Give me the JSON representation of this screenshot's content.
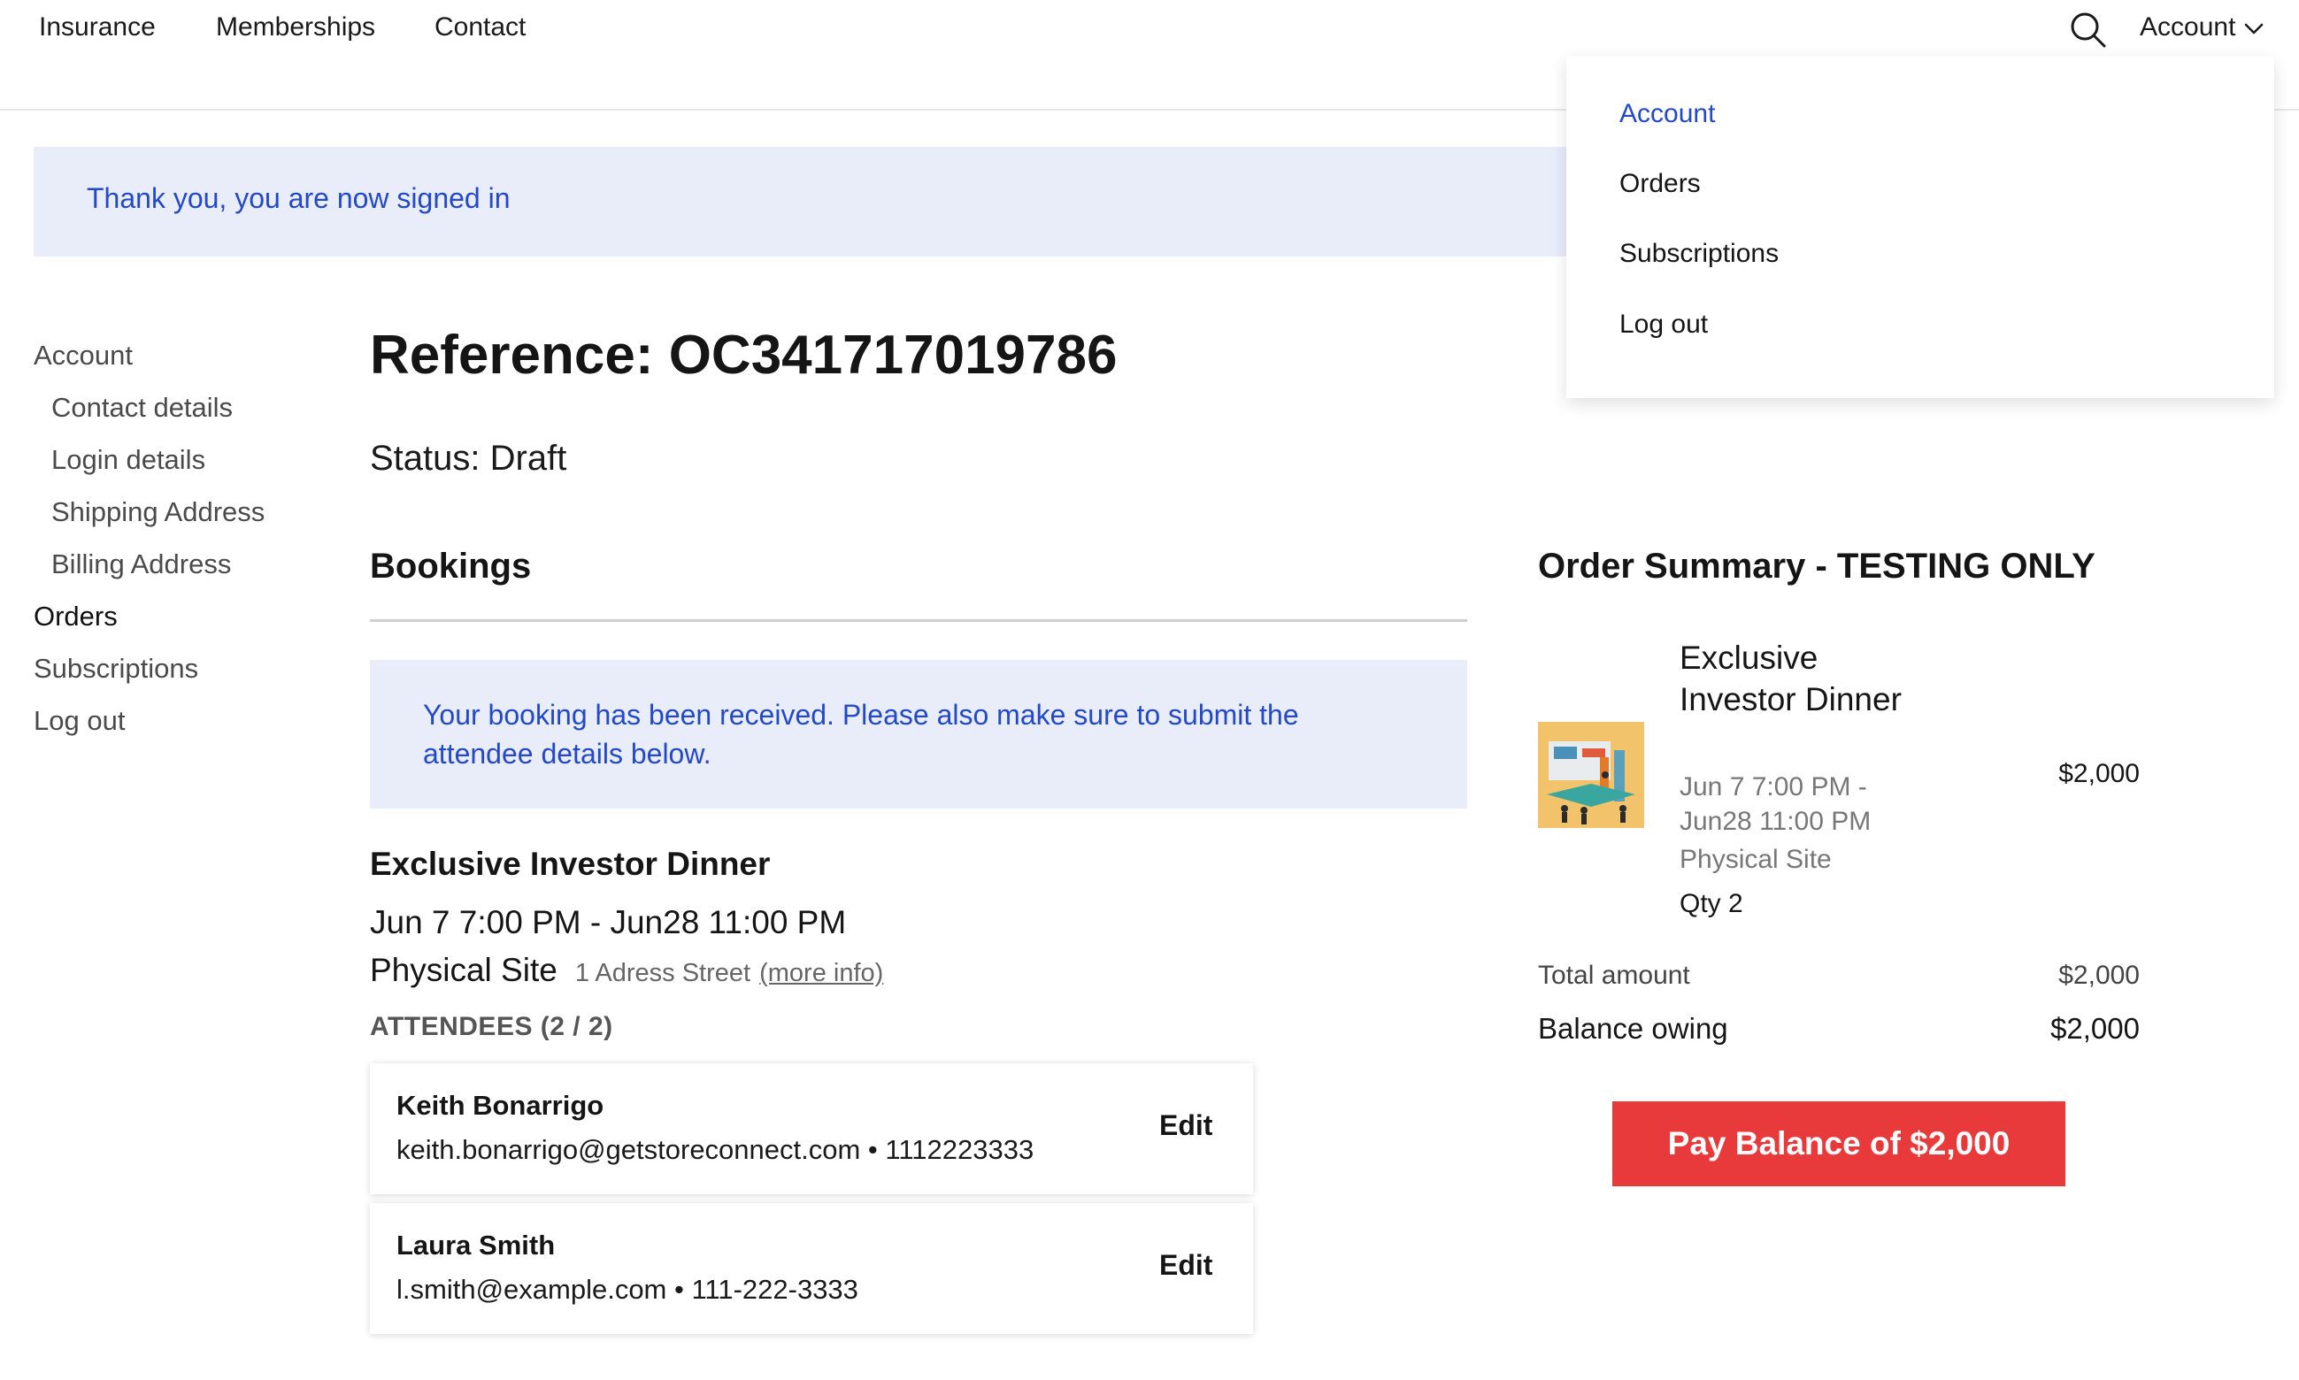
{
  "nav": {
    "links": [
      "Insurance",
      "Memberships",
      "Contact"
    ],
    "search_icon": "search-icon",
    "account_label": "Account"
  },
  "alerts": {
    "signin": "Thank you, you are now signed in",
    "booking": "Your booking has been received. Please also make sure to submit the attendee details below."
  },
  "sidebar": {
    "items": [
      {
        "label": "Account"
      },
      {
        "label": "Contact details"
      },
      {
        "label": "Login details"
      },
      {
        "label": "Shipping Address"
      },
      {
        "label": "Billing Address"
      },
      {
        "label": "Orders"
      },
      {
        "label": "Subscriptions"
      },
      {
        "label": "Log out"
      }
    ]
  },
  "order": {
    "reference": "Reference: OC341717019786",
    "status": "Status: Draft",
    "bookings_heading": "Bookings",
    "event": {
      "name": "Exclusive Investor Dinner",
      "dates": "Jun 7 7:00 PM - Jun28 11:00 PM",
      "site": "Physical Site",
      "address": "1 Adress Street",
      "more_info": "(more info)"
    },
    "attendees_heading": "ATTENDEES (2 / 2)",
    "attendees": [
      {
        "name": "Keith Bonarrigo",
        "info": "keith.bonarrigo@getstoreconnect.com • 1112223333",
        "edit": "Edit"
      },
      {
        "name": "Laura Smith",
        "info": "l.smith@example.com • 111-222-3333",
        "edit": "Edit"
      }
    ]
  },
  "summary": {
    "heading": "Order Summary - TESTING ONLY",
    "item": {
      "name": "Exclusive Investor Dinner",
      "dates": "Jun 7 7:00 PM - Jun28 11:00 PM",
      "site": "Physical Site",
      "qty": "Qty 2",
      "price": "$2,000"
    },
    "total_label": "Total amount",
    "total_value": "$2,000",
    "balance_label": "Balance owing",
    "balance_value": "$2,000",
    "pay_button": "Pay Balance of $2,000"
  },
  "dropdown": {
    "items": [
      {
        "label": "Account"
      },
      {
        "label": "Orders"
      },
      {
        "label": "Subscriptions"
      },
      {
        "label": "Log out"
      }
    ]
  },
  "colors": {
    "accent_blue": "#2349c6",
    "alert_bg": "#e9edfa",
    "pay_red": "#e8393b"
  }
}
